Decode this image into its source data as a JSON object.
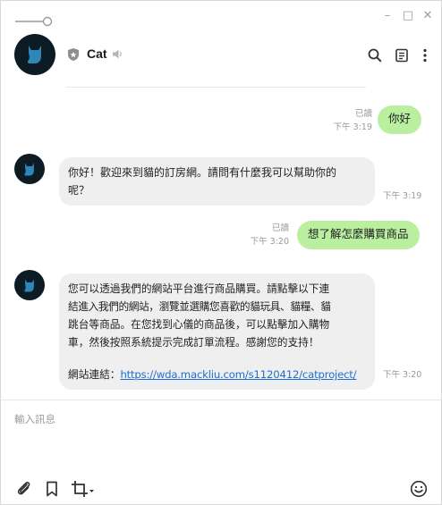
{
  "chat": {
    "name": "Cat",
    "icons": {
      "pin": "pin-slider-icon",
      "minimize": "minimize-icon",
      "maximize": "maximize-icon",
      "close": "close-icon",
      "shield": "shield-icon",
      "mute": "speaker-muted-icon",
      "search": "search-icon",
      "notes": "notes-icon",
      "more": "more-vertical-icon"
    },
    "window_controls": {
      "minimize": "–",
      "maximize": "□",
      "close": "✕"
    }
  },
  "messages": [
    {
      "direction": "out",
      "text": "你好",
      "read": "已讀",
      "time": "下午 3:19"
    },
    {
      "direction": "in",
      "line1": "你好！歡迎來到貓的訂房網。請問有什麼我可以幫助你的",
      "line2": "呢？",
      "time": "下午 3:19"
    },
    {
      "direction": "out",
      "text": "想了解怎麼購買商品",
      "read": "已讀",
      "time": "下午 3:20"
    },
    {
      "direction": "in",
      "line1": "您可以透過我們的網站平台進行商品購買。請點擊以下連",
      "line2": "結進入我們的網站，瀏覽並選購您喜歡的貓玩具、貓糧、貓",
      "line3": "跳台等商品。在您找到心儀的商品後，可以點擊加入購物",
      "line4": "車，然後按照系統提示完成訂單流程。感謝您的支持！",
      "link_prefix": "網站連結：",
      "link_text": "https://wda.mackliu.com/s1120412/catproject/",
      "time": "下午 3:20"
    }
  ],
  "composer": {
    "placeholder": "輸入訊息",
    "icons": {
      "attach": "paperclip-icon",
      "bookmark": "bookmark-icon",
      "crop": "crop-icon",
      "emoji": "emoji-icon"
    }
  },
  "colors": {
    "outgoing_bubble": "#b9ef9f",
    "incoming_bubble": "#efefef",
    "avatar": "#0c1b24",
    "link": "#1d6fd6"
  }
}
